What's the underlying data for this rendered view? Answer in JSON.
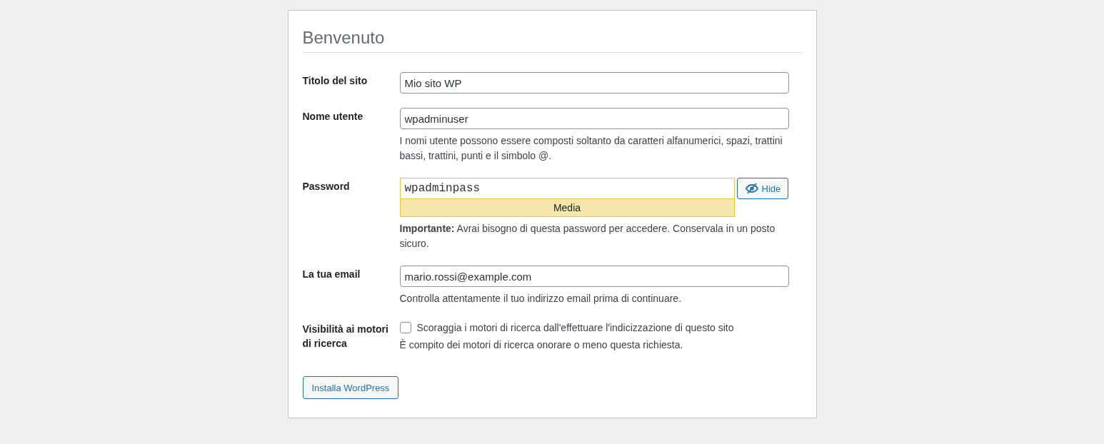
{
  "heading": "Benvenuto",
  "fields": [
    {
      "kind": "text",
      "label": "Titolo del sito",
      "value": "Mio sito WP"
    },
    {
      "kind": "text",
      "label": "Nome utente",
      "value": "wpadminuser",
      "description": "I nomi utente possono essere composti soltanto da caratteri alfanumerici, spazi, trattini bassi, trattini, punti e il simbolo @."
    },
    {
      "kind": "password",
      "label": "Password",
      "value": "wpadminpass",
      "toggle": "Hide",
      "strength": "Media",
      "description": "**Importante:** Avrai bisogno di questa password per accedere. Conservala in un posto sicuro."
    },
    {
      "kind": "text",
      "label": "La tua email",
      "value": "mario.rossi@example.com",
      "description": "Controlla attentamente il tuo indirizzo email prima di continuare."
    },
    {
      "kind": "checkbox",
      "label": "Visibilità ai motori di ricerca",
      "option": "Scoraggia i motori di ricerca dall'effettuare l'indicizzazione di questo sito",
      "checked": false,
      "description": "È compito dei motori di ricerca onorare o meno questa richiesta."
    }
  ],
  "submit": "Installa WordPress"
}
